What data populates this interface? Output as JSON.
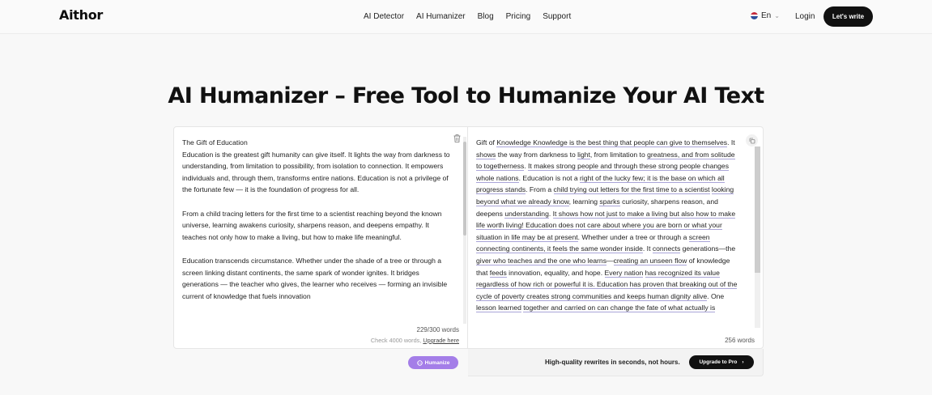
{
  "header": {
    "logo": "Aithor",
    "nav": [
      "AI Detector",
      "AI Humanizer",
      "Blog",
      "Pricing",
      "Support"
    ],
    "language": "En",
    "login": "Login",
    "cta": "Let's write"
  },
  "main": {
    "title": "AI Humanizer – Free Tool to Humanize Your AI Text"
  },
  "input_panel": {
    "text": "The Gift of Education\nEducation is the greatest gift humanity can give itself. It lights the way from darkness to understanding, from limitation to possibility, from isolation to connection. It empowers individuals and, through them, transforms entire nations. Education is not a privilege of the fortunate few — it is the foundation of progress for all.\n\nFrom a child tracing letters for the first time to a scientist reaching beyond the known universe, learning awakens curiosity, sharpens reason, and deepens empathy. It teaches not only how to make a living, but how to make life meaningful.\n\nEducation transcends circumstance. Whether under the shade of a tree or through a screen linking distant continents, the same spark of wonder ignites. It bridges generations — the teacher who gives, the learner who receives — forming an invisible current of knowledge that fuels innovation",
    "word_count": "229/300 words",
    "limit_note": "Check 4000 words,",
    "upgrade_link": "Upgrade here",
    "humanize_button": "Humanize"
  },
  "output_panel": {
    "segments": [
      {
        "t": "Gift of "
      },
      {
        "t": "Knowledge Knowledge is the best thing that people can give to themselves",
        "hl": true
      },
      {
        "t": ". It "
      },
      {
        "t": "shows",
        "hl": true
      },
      {
        "t": " the way from darkness to "
      },
      {
        "t": "light",
        "hl": true
      },
      {
        "t": ", from limitation to "
      },
      {
        "t": "greatness, and from solitude to togetherness",
        "hl": true
      },
      {
        "t": ". "
      },
      {
        "t": "It makes strong people and through these strong people changes whole nations",
        "hl": true
      },
      {
        "t": ". Education is not a "
      },
      {
        "t": "right of the lucky few; it is the base on which all progress stands",
        "hl": true
      },
      {
        "t": ". From a "
      },
      {
        "t": "child trying out letters for the first time to a scientist",
        "hl": true
      },
      {
        "t": " "
      },
      {
        "t": "looking beyond what we already know",
        "hl": true
      },
      {
        "t": ", learning "
      },
      {
        "t": "sparks",
        "hl": true
      },
      {
        "t": " curiosity, sharpens reason, and deepens "
      },
      {
        "t": "understanding",
        "hl": true
      },
      {
        "t": ". "
      },
      {
        "t": "It shows how not just to make a living but also how to make life worth living! Education does not care about where you are born or what your situation in life may be at present",
        "hl": true
      },
      {
        "t": ". Whether under a tree or through a "
      },
      {
        "t": "screen connecting continents, it feels the same wonder inside",
        "hl": true
      },
      {
        "t": ". It "
      },
      {
        "t": "connects",
        "hl": true
      },
      {
        "t": " generations—the "
      },
      {
        "t": "giver who teaches and the one who learns",
        "hl": true
      },
      {
        "t": "—"
      },
      {
        "t": "creating an unseen flow",
        "hl": true
      },
      {
        "t": " of knowledge that "
      },
      {
        "t": "feeds",
        "hl": true
      },
      {
        "t": " innovation, equality, and hope. "
      },
      {
        "t": "Every nation",
        "hl": true
      },
      {
        "t": " "
      },
      {
        "t": "has recognized its value regardless of how rich or powerful it is. Education has proven that breaking out of the cycle of poverty creates strong communities and keeps human dignity alive",
        "hl": true
      },
      {
        "t": ". One "
      },
      {
        "t": "lesson learned",
        "hl": true
      },
      {
        "t": " "
      },
      {
        "t": "together and carried on can change the fate of what actually is",
        "hl": true
      }
    ],
    "word_count": "256 words",
    "promo_text": "High-quality rewrites in seconds, not hours.",
    "promo_button": "Upgrade to Pro"
  },
  "colors": {
    "accent": "#a47ee8",
    "dark": "#111111",
    "highlight_underline": "#a9a4d8"
  }
}
